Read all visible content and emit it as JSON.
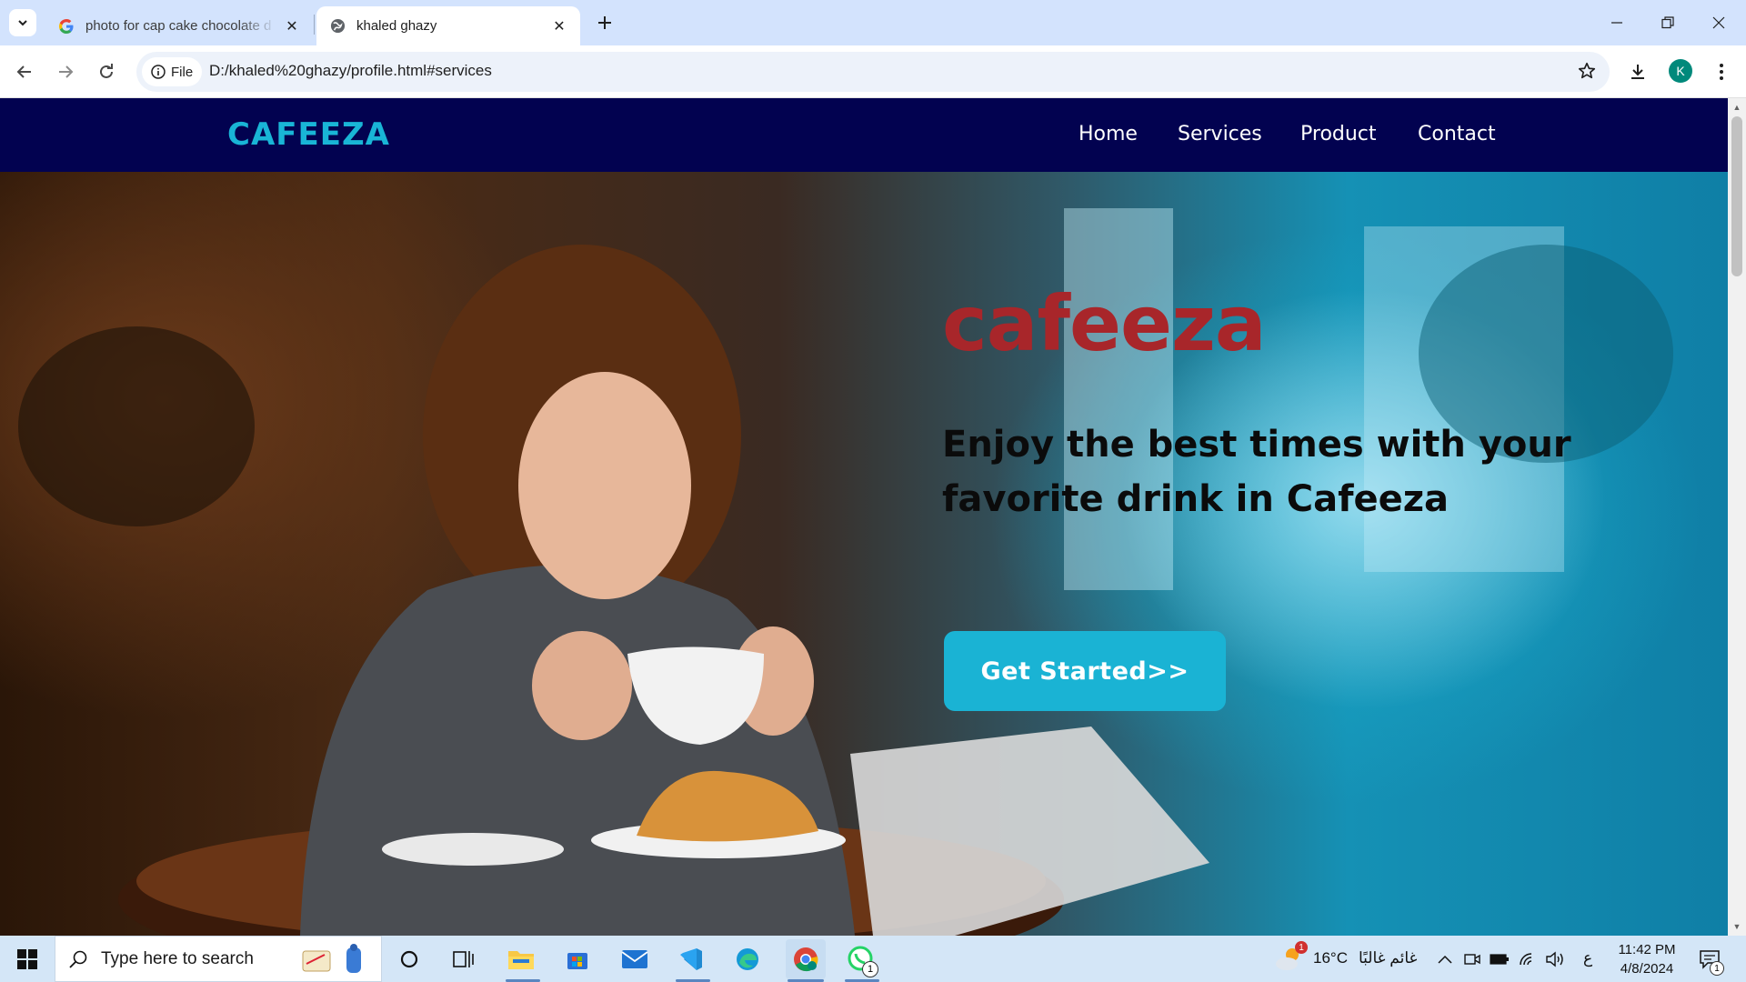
{
  "browser": {
    "tabs": [
      {
        "title": "photo for cap cake chocolate d",
        "active": false
      },
      {
        "title": "khaled ghazy",
        "active": true
      }
    ],
    "address_chip": "File",
    "url": "D:/khaled%20ghazy/profile.html#services",
    "profile_initial": "K"
  },
  "site": {
    "logo": "CAFEEZA",
    "nav": [
      "Home",
      "Services",
      "Product",
      "Contact"
    ],
    "hero": {
      "title": "cafeeza",
      "subtitle": "Enjoy the best times with your favorite drink in Cafeeza",
      "cta": "Get Started>>"
    },
    "colors": {
      "nav_bg": "#020250",
      "accent": "#19b5d6",
      "title": "#a8262a"
    }
  },
  "taskbar": {
    "search_placeholder": "Type here to search",
    "weather_temp": "16°C",
    "weather_text": "غائم غالبًا",
    "weather_badge": "1",
    "language": "ع",
    "time": "11:42 PM",
    "date": "4/8/2024",
    "notification_count": "1",
    "whatsapp_badge": "1"
  }
}
